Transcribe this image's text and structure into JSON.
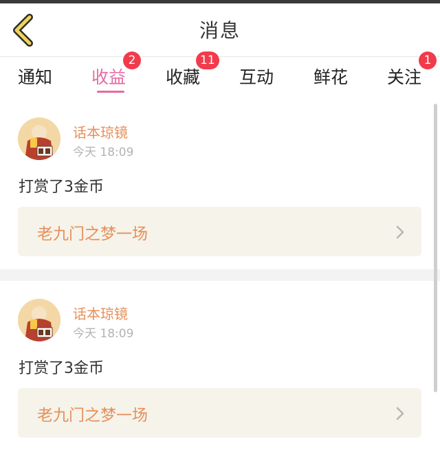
{
  "header": {
    "title": "消息"
  },
  "tabs": [
    {
      "label": "通知",
      "badge": ""
    },
    {
      "label": "收益",
      "badge": "2",
      "active": true
    },
    {
      "label": "收藏",
      "badge": "11"
    },
    {
      "label": "互动",
      "badge": ""
    },
    {
      "label": "鲜花",
      "badge": ""
    },
    {
      "label": "关注",
      "badge": "1"
    }
  ],
  "messages": [
    {
      "username": "话本琼镜",
      "time": "今天 18:09",
      "text": "打赏了3金币",
      "link": "老九门之梦一场"
    },
    {
      "username": "话本琼镜",
      "time": "今天 18:09",
      "text": "打赏了3金币",
      "link": "老九门之梦一场"
    }
  ],
  "colors": {
    "accent": "#e66aa6",
    "badge": "#f23b4a",
    "name": "#e6905a",
    "back_icon": "#f0d35a"
  },
  "icons": {
    "back": "back-arrow-icon",
    "chevron": "chevron-right-icon"
  }
}
